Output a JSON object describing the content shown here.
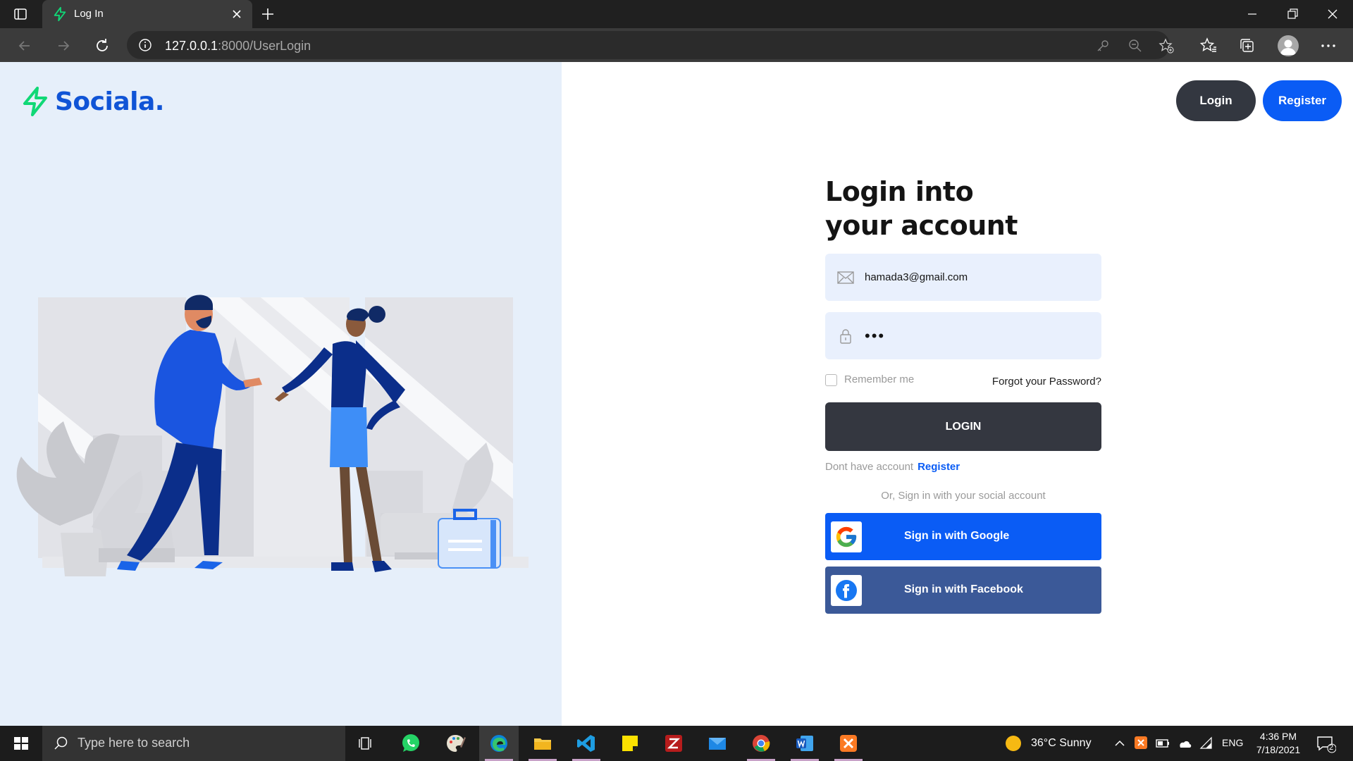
{
  "browser": {
    "tab_title": "Log In",
    "address_host": "127.0.0.1",
    "address_path": ":8000/UserLogin"
  },
  "brand": {
    "name": "Sociala.",
    "accent": "#1054d6",
    "logo_color": "#10d876"
  },
  "header": {
    "login_label": "Login",
    "register_label": "Register"
  },
  "form": {
    "title_line1": "Login into",
    "title_line2": "your account",
    "email_value": "hamada3@gmail.com",
    "password_value": "•••",
    "remember_label": "Remember me",
    "forgot_label": "Forgot your Password?",
    "login_button": "LOGIN",
    "no_account_text": "Dont have account",
    "register_link": "Register",
    "social_text": "Or, Sign in with your social account",
    "google_button": "Sign in with Google",
    "facebook_button": "Sign in with Facebook"
  },
  "taskbar": {
    "search_placeholder": "Type here to search",
    "weather": "36°C  Sunny",
    "language": "ENG",
    "time": "4:36 PM",
    "date": "7/18/2021",
    "notifications": "2"
  }
}
